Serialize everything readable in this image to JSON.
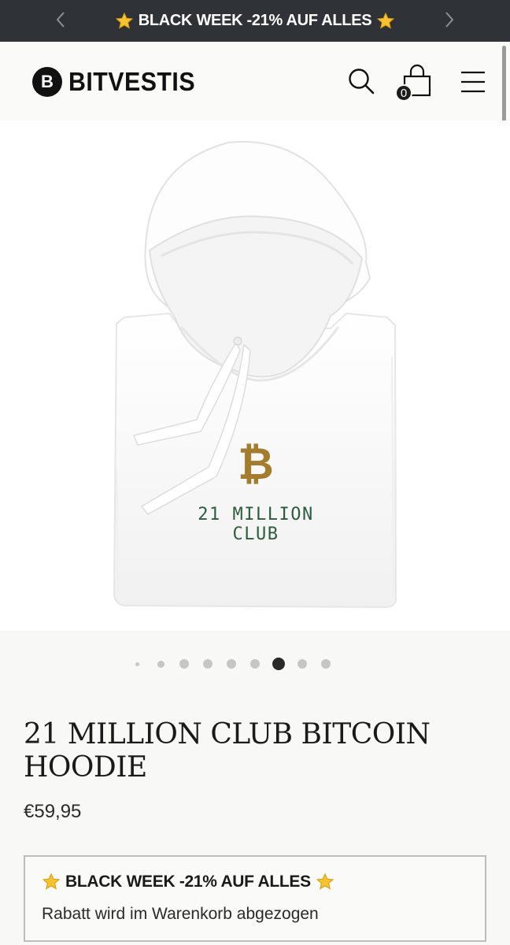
{
  "announcement": {
    "text": "BLACK WEEK -21% AUF ALLES",
    "prev_icon": "chevron-left-icon",
    "next_icon": "chevron-right-icon"
  },
  "header": {
    "brand": "BITVESTIS",
    "logo_glyph": "B",
    "cart_count": "0",
    "icons": [
      "search-icon",
      "shopping-bag-icon",
      "hamburger-menu-icon"
    ]
  },
  "gallery": {
    "image_subject": "folded white hoodie",
    "print_glyph": "₿",
    "print_text": "21 MILLION CLUB",
    "dot_count": 9,
    "active_dot_index": 6
  },
  "product": {
    "title": "21 MILLION CLUB BITCOIN HOODIE",
    "price": "€59,95"
  },
  "promo": {
    "headline": "BLACK WEEK -21% AUF ALLES",
    "subline": "Rabatt wird im Warenkorb abgezogen"
  },
  "colors": {
    "announcement_bg": "#2f3236",
    "page_bg": "#f8f8f6",
    "print_gold": "#a37c2e",
    "print_green": "#2d5b3d",
    "star": "#f5c230"
  }
}
